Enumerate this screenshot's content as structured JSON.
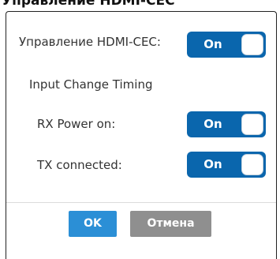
{
  "dialog": {
    "title": "Управление HDMI-CEC",
    "hdmi_cec": {
      "label": "Управление HDMI-CEC:",
      "toggle_label": "On"
    },
    "section_title": "Input Change Timing",
    "rx_power": {
      "label": "RX Power on:",
      "toggle_label": "On"
    },
    "tx_connected": {
      "label": "TX connected:",
      "toggle_label": "On"
    },
    "buttons": {
      "ok_label": "OK",
      "cancel_label": "Отмена"
    }
  },
  "colors": {
    "toggle_on": "#0a66ad",
    "ok_button": "#2b8fd6",
    "cancel_button": "#8f8f8f"
  }
}
